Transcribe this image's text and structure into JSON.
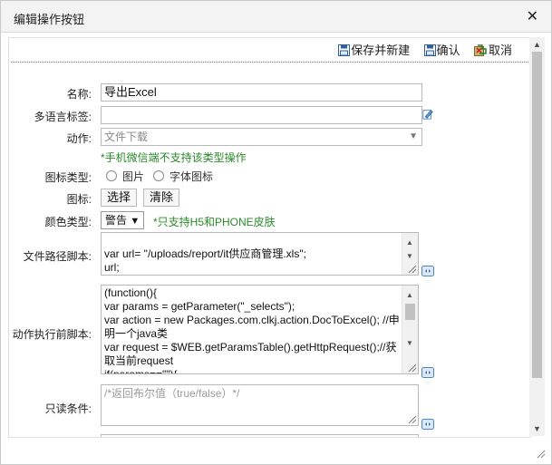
{
  "dialog": {
    "title": "编辑操作按钮",
    "close_icon": "close-icon"
  },
  "toolbar": {
    "save_new": "保存并新建",
    "confirm": "确认",
    "cancel": "取消"
  },
  "form": {
    "name_label": "名称:",
    "name_value": "导出Excel",
    "i18n_label": "多语言标签:",
    "i18n_value": "",
    "action_label": "动作:",
    "action_value": "文件下载",
    "action_hint": "*手机微信端不支持该类型操作",
    "icon_type_label": "图标类型:",
    "icon_type_opt1": "图片",
    "icon_type_opt2": "字体图标",
    "icon_label": "图标:",
    "icon_select_btn": "选择",
    "icon_clear_btn": "清除",
    "color_label": "颜色类型:",
    "color_value": "警告",
    "color_hint": "*只支持H5和PHONE皮肤",
    "filepath_label": "文件路径脚本:",
    "filepath_value": "var url= \"/uploads/report/it供应商管理.xls\";\nurl;",
    "pre_action_label": "动作执行前脚本:",
    "pre_action_value": "(function(){\nvar params = getParameter(\"_selects\");\nvar action = new Packages.com.clkj.action.DocToExcel(); //申明一个java类\nvar request = $WEB.getParamsTable().getHttpRequest();//获取当前request\nif(params==\"\"){",
    "readonly_label": "只读条件:",
    "readonly_placeholder": "/*返回布尔值（true/false）*/"
  }
}
